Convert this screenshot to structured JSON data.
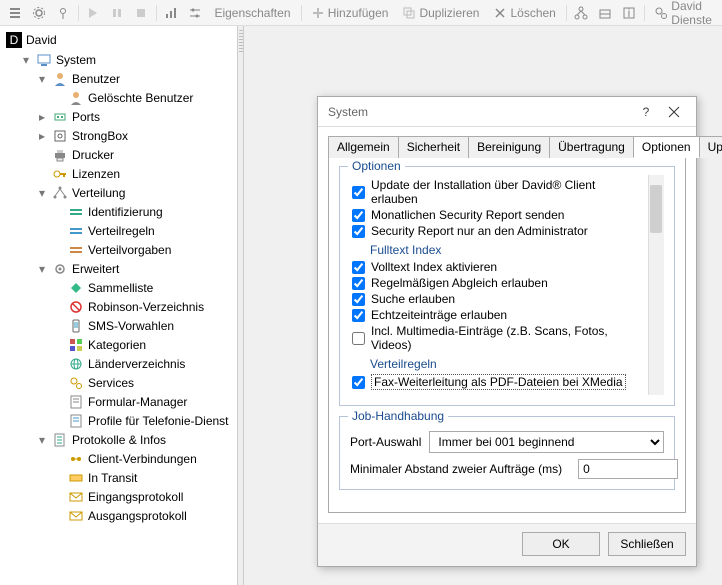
{
  "toolbar": {
    "eigenschaften": "Eigenschaften",
    "hinzufuegen": "Hinzufügen",
    "duplizieren": "Duplizieren",
    "loeschen": "Löschen",
    "david_dienste": "David Dienste"
  },
  "tree": {
    "root": "David",
    "system": "System",
    "benutzer": "Benutzer",
    "geloeschte_benutzer": "Gelöschte Benutzer",
    "ports": "Ports",
    "strongbox": "StrongBox",
    "drucker": "Drucker",
    "lizenzen": "Lizenzen",
    "verteilung": "Verteilung",
    "identifizierung": "Identifizierung",
    "verteilregeln": "Verteilregeln",
    "verteilvorgaben": "Verteilvorgaben",
    "erweitert": "Erweitert",
    "sammelliste": "Sammelliste",
    "robinson": "Robinson-Verzeichnis",
    "sms_vorwahlen": "SMS-Vorwahlen",
    "kategorien": "Kategorien",
    "laenderverzeichnis": "Länderverzeichnis",
    "services": "Services",
    "formular_manager": "Formular-Manager",
    "profile_telefonie": "Profile für Telefonie-Dienst",
    "protokolle": "Protokolle & Infos",
    "client_verbindungen": "Client-Verbindungen",
    "in_transit": "In Transit",
    "eingangsprotokoll": "Eingangsprotokoll",
    "ausgangsprotokoll": "Ausgangsprotokoll"
  },
  "dialog": {
    "title": "System",
    "tabs": {
      "allgemein": "Allgemein",
      "sicherheit": "Sicherheit",
      "bereinigung": "Bereinigung",
      "uebertragung": "Übertragung",
      "optionen": "Optionen",
      "updates": "Updates"
    },
    "groups": {
      "optionen": "Optionen",
      "fulltext": "Fulltext Index",
      "verteilregeln": "Verteilregeln",
      "job": "Job-Handhabung"
    },
    "options": {
      "update_install": "Update der Installation über David® Client erlauben",
      "monthly_report": "Monatlichen Security Report senden",
      "report_admin": "Security Report nur an den Administrator",
      "ft_activate": "Volltext Index aktivieren",
      "ft_abgleich": "Regelmäßigen Abgleich erlauben",
      "ft_search": "Suche erlauben",
      "ft_echtzeit": "Echtzeiteinträge erlauben",
      "ft_multimedia": "Incl. Multimedia-Einträge (z.B. Scans, Fotos, Videos)",
      "vr_fax": "Fax-Weiterleitung als PDF-Dateien bei XMedia"
    },
    "job": {
      "port_label": "Port-Auswahl",
      "port_value": "Immer bei 001 beginnend",
      "min_abstand_label": "Minimaler Abstand zweier Aufträge (ms)",
      "min_abstand_value": "0"
    },
    "buttons": {
      "ok": "OK",
      "close": "Schließen"
    }
  }
}
